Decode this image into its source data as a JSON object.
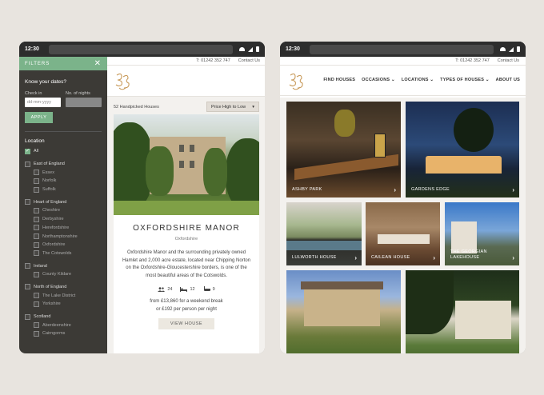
{
  "left_device": {
    "status_time": "12:30",
    "filters": {
      "header": "FILTERS",
      "dates_title": "Know your dates?",
      "checkin_label": "Check in",
      "checkin_placeholder": "dd-mm-yyyy",
      "nights_label": "No. of nights",
      "apply": "APPLY",
      "location_title": "Location",
      "items": [
        {
          "label": "All",
          "checked": true,
          "level": 0
        },
        {
          "label": "East of England",
          "checked": false,
          "level": 0
        },
        {
          "label": "Essex",
          "checked": false,
          "level": 1
        },
        {
          "label": "Norfolk",
          "checked": false,
          "level": 1
        },
        {
          "label": "Suffolk",
          "checked": false,
          "level": 1
        },
        {
          "label": "Heart of England",
          "checked": false,
          "level": 0
        },
        {
          "label": "Cheshire",
          "checked": false,
          "level": 1
        },
        {
          "label": "Derbyshire",
          "checked": false,
          "level": 1
        },
        {
          "label": "Herefordshire",
          "checked": false,
          "level": 1
        },
        {
          "label": "Northamptonshire",
          "checked": false,
          "level": 1
        },
        {
          "label": "Oxfordshire",
          "checked": false,
          "level": 1
        },
        {
          "label": "The Cotswolds",
          "checked": false,
          "level": 1
        },
        {
          "label": "Ireland",
          "checked": false,
          "level": 0
        },
        {
          "label": "County Kildare",
          "checked": false,
          "level": 1
        },
        {
          "label": "North of England",
          "checked": false,
          "level": 0
        },
        {
          "label": "The Lake District",
          "checked": false,
          "level": 1
        },
        {
          "label": "Yorkshire",
          "checked": false,
          "level": 1
        },
        {
          "label": "Scotland",
          "checked": false,
          "level": 0
        },
        {
          "label": "Aberdeenshire",
          "checked": false,
          "level": 1
        },
        {
          "label": "Cairngorms",
          "checked": false,
          "level": 1
        }
      ]
    },
    "topbar": {
      "phone": "T: 01242 352 747",
      "contact": "Contact Us"
    },
    "listing": {
      "count": "52 Handpicked Houses",
      "sort": "Price High to Low",
      "card": {
        "name": "OXFORDSHIRE MANOR",
        "location": "Oxfordshire",
        "description": "Oxfordshire Manor and the surrounding privately owned Hamlet and 2,000 acre estate, located near Chipping Norton on the Oxfordshire-Gloucestershire borders, is one of the most beautiful areas of the Cotswolds.",
        "guests": "24",
        "bedrooms": "12",
        "bathrooms": "9",
        "price_line1": "from £13,860 for a weekend break",
        "price_line2": "or £192 per person per night",
        "button": "VIEW HOUSE"
      }
    }
  },
  "right_device": {
    "status_time": "12:30",
    "topbar": {
      "phone": "T: 01242 352 747",
      "contact": "Contact Us"
    },
    "nav": [
      "FIND HOUSES",
      "OCCASIONS",
      "LOCATIONS",
      "TYPES OF HOUSES",
      "ABOUT US"
    ],
    "tiles": [
      "ASHBY PARK",
      "GARDENS EDGE",
      "LULWORTH HOUSE",
      "CAILEAN HOUSE",
      "THE GEORGIAN LAKEHOUSE",
      "",
      ""
    ]
  },
  "colors": {
    "accent": "#7bb38a",
    "logo": "#c89a5a",
    "panel": "#3c3a36"
  }
}
